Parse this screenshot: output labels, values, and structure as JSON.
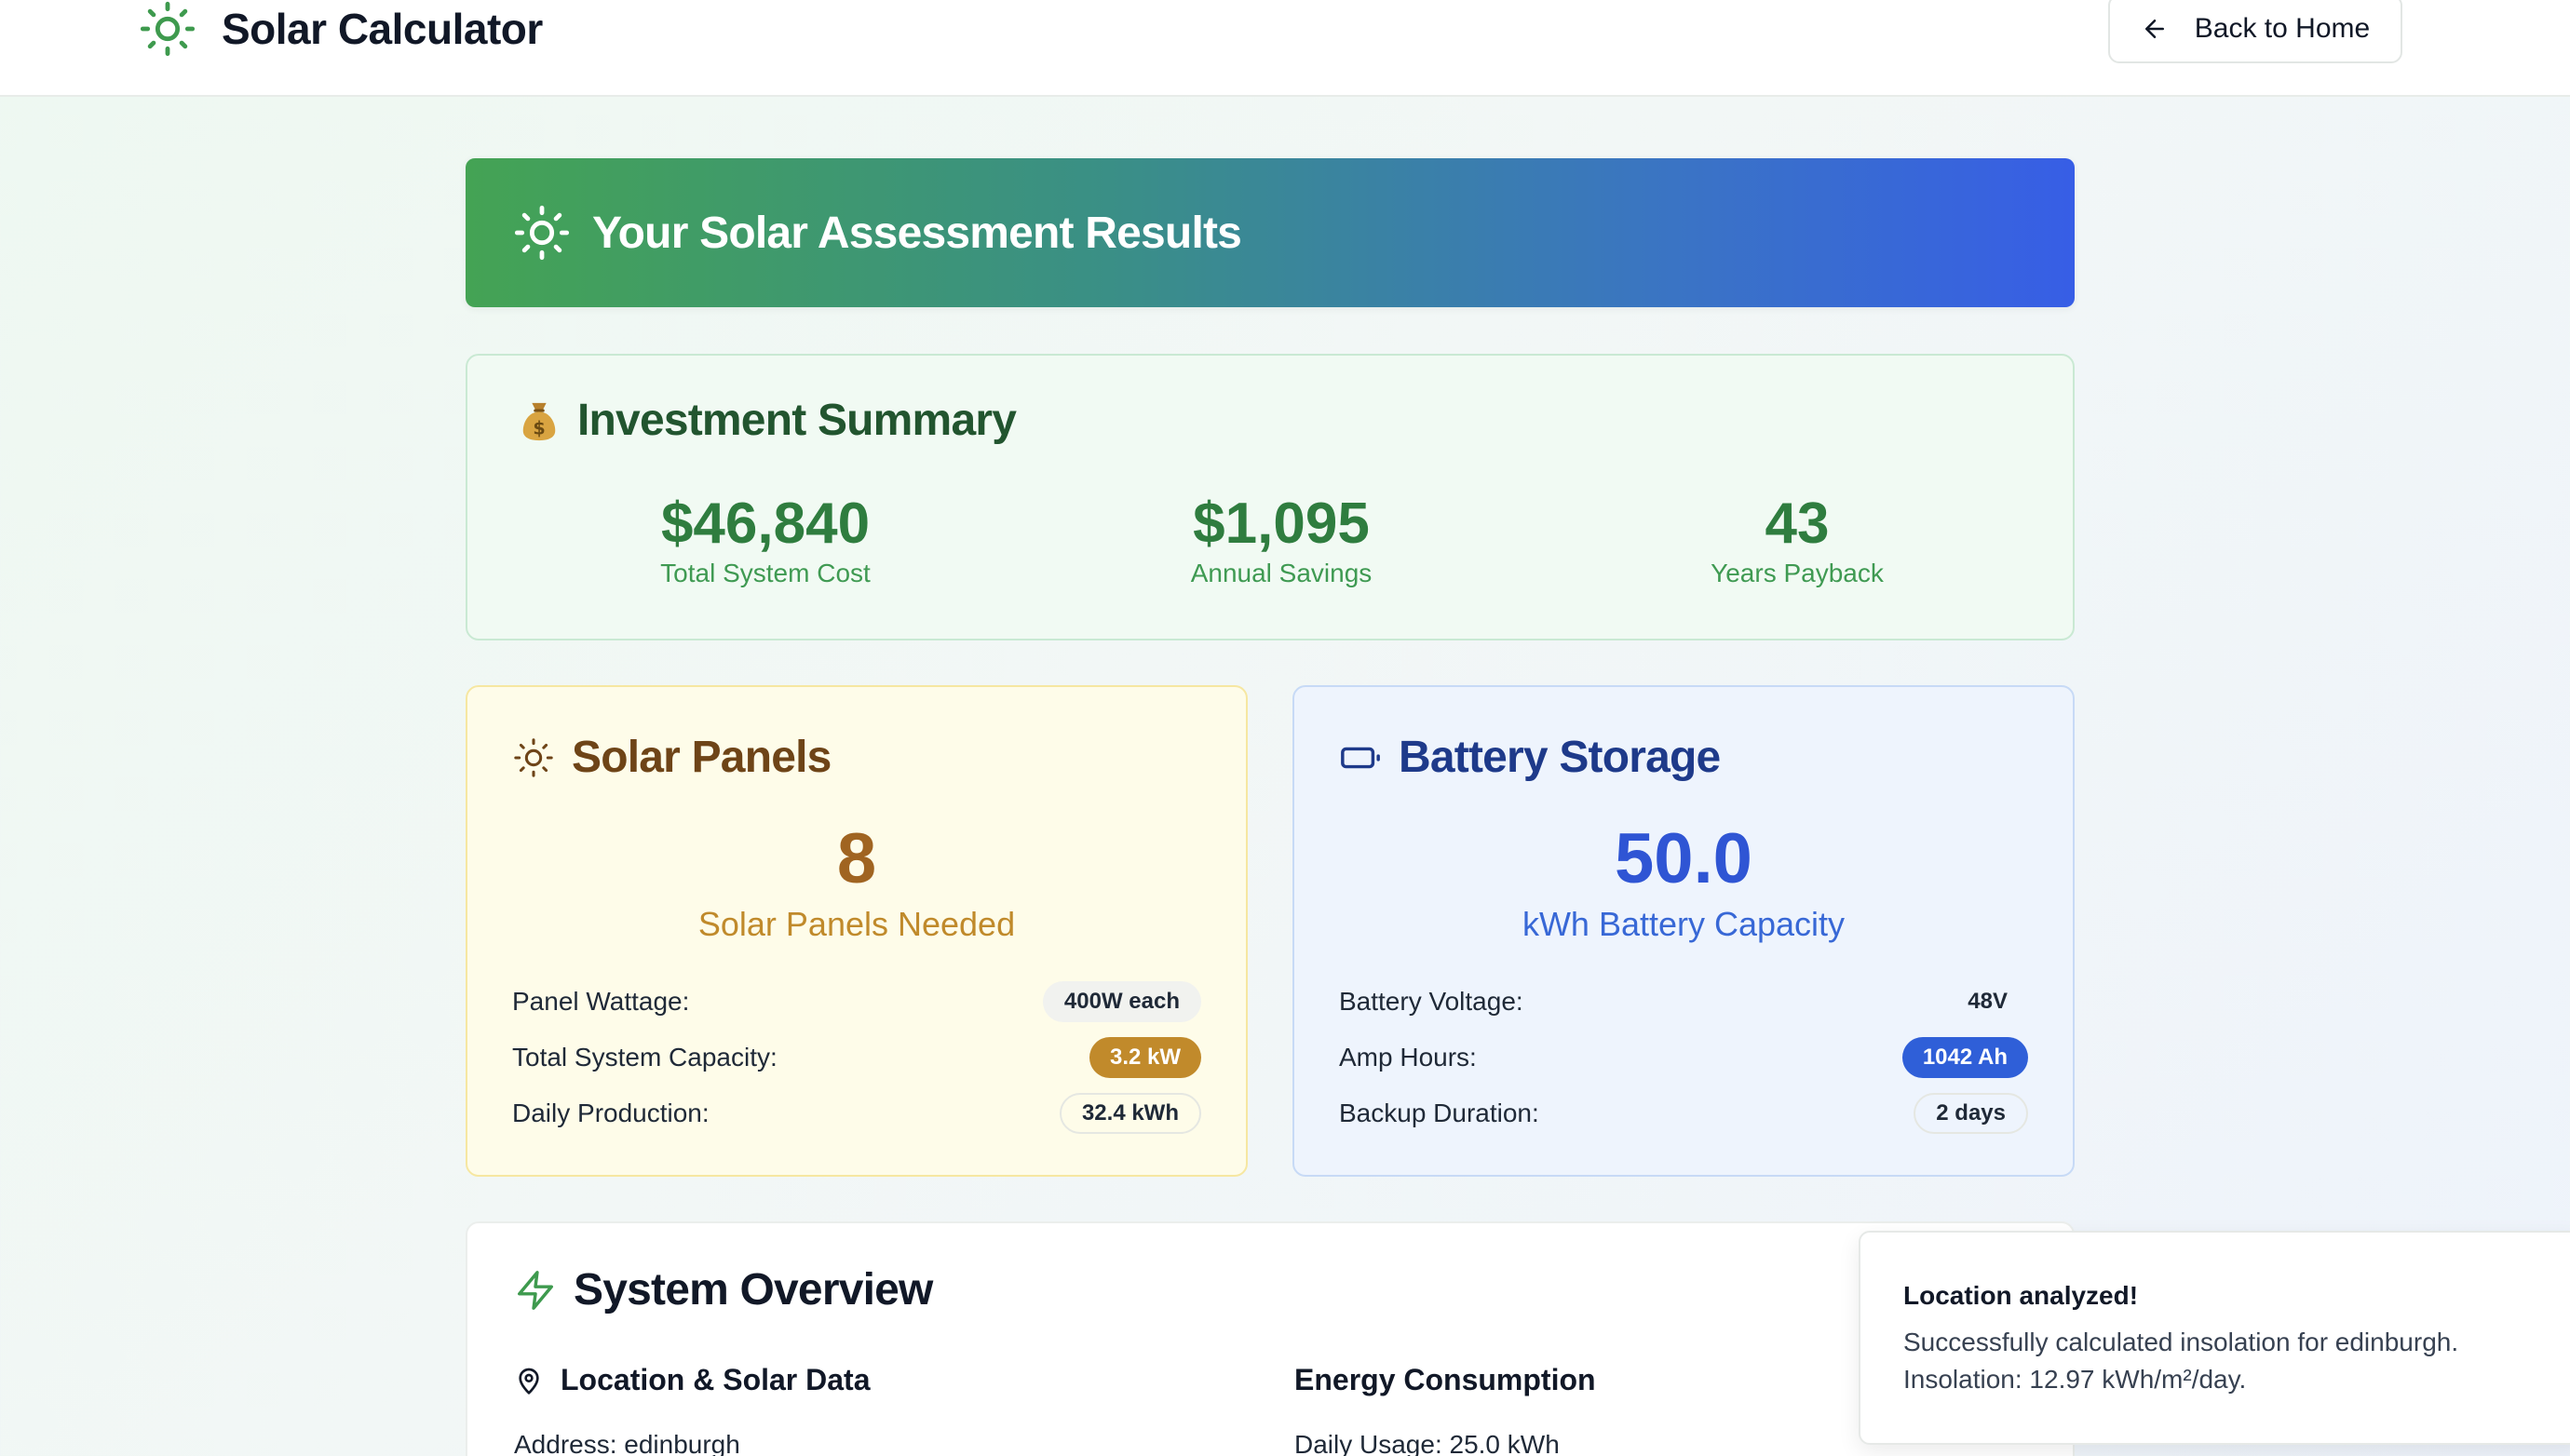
{
  "header": {
    "app_title": "Solar Calculator",
    "app_icon": "sun-icon",
    "back_label": "Back to Home",
    "back_icon": "arrow-left-icon"
  },
  "banner": {
    "title": "Your Solar Assessment Results",
    "icon": "sun-icon"
  },
  "investment": {
    "icon": "money-bag-icon",
    "title": "Investment Summary",
    "stats": [
      {
        "value": "$46,840",
        "label": "Total System Cost"
      },
      {
        "value": "$1,095",
        "label": "Annual Savings"
      },
      {
        "value": "43",
        "label": "Years Payback"
      }
    ]
  },
  "solar_panels": {
    "icon": "sun-icon",
    "title": "Solar Panels",
    "count": "8",
    "count_label": "Solar Panels Needed",
    "rows": [
      {
        "label": "Panel Wattage:",
        "value": "400W each"
      },
      {
        "label": "Total System Capacity:",
        "value": "3.2 kW"
      },
      {
        "label": "Daily Production:",
        "value": "32.4 kWh"
      }
    ]
  },
  "battery": {
    "icon": "battery-icon",
    "title": "Battery Storage",
    "capacity": "50.0",
    "capacity_label": "kWh Battery Capacity",
    "rows": [
      {
        "label": "Battery Voltage:",
        "value": "48V"
      },
      {
        "label": "Amp Hours:",
        "value": "1042 Ah"
      },
      {
        "label": "Backup Duration:",
        "value": "2 days"
      }
    ]
  },
  "overview": {
    "icon": "lightning-icon",
    "title": "System Overview",
    "location": {
      "icon": "map-pin-icon",
      "heading": "Location & Solar Data",
      "address": "Address: edinburgh"
    },
    "energy": {
      "heading": "Energy Consumption",
      "daily_usage": "Daily Usage: 25.0 kWh"
    }
  },
  "toast": {
    "title": "Location analyzed!",
    "message": "Successfully calculated insolation for edinburgh. Insolation: 12.97 kWh/m²/day."
  },
  "colors": {
    "brand_green": "#3e9a4e",
    "banner_start": "#44a354",
    "banner_end": "#375ee6",
    "solar_accent": "#c18a2b",
    "battery_accent": "#2f5fd8"
  }
}
